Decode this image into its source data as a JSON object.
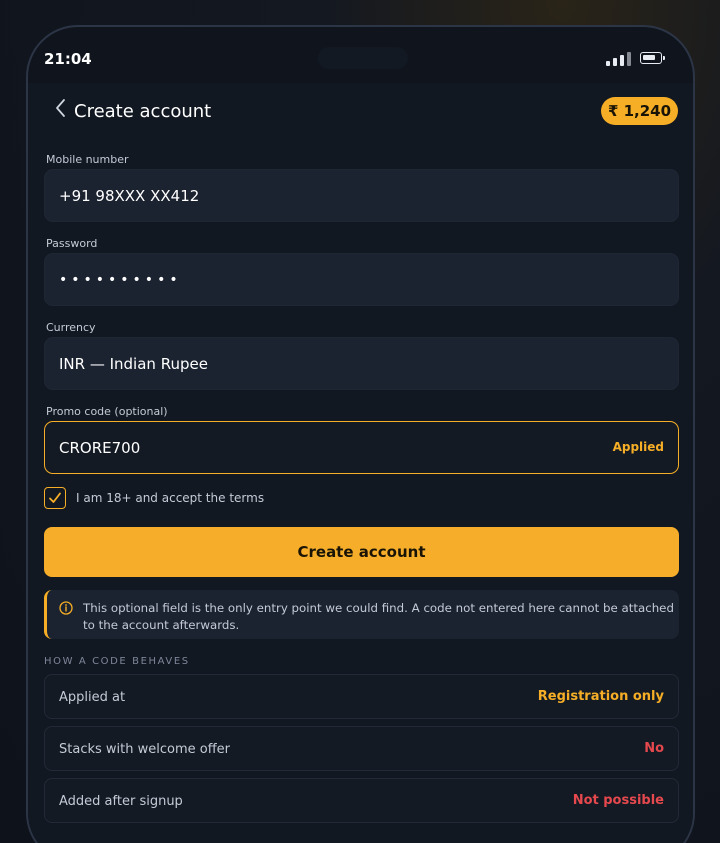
{
  "status_bar": {
    "time": "21:04"
  },
  "header": {
    "title": "Create account",
    "balance": "₹ 1,240"
  },
  "form": {
    "mobile": {
      "label": "Mobile number",
      "value": "+91 98XXX XX412"
    },
    "password": {
      "label": "Password",
      "value": "••••••••••"
    },
    "currency": {
      "label": "Currency",
      "value": "INR — Indian Rupee"
    },
    "promo": {
      "label": "Promo code (optional)",
      "value": "CRORE700",
      "status": "Applied"
    },
    "terms": {
      "label": "I am 18+ and accept the terms",
      "checked": true
    },
    "submit_label": "Create account"
  },
  "notice": {
    "text": "This optional field is the only entry point we could find. A code not entered here cannot be attached to the account afterwards."
  },
  "code_behaviour": {
    "title": "HOW A CODE BEHAVES",
    "rows": [
      {
        "label": "Applied at",
        "value": "Registration only",
        "color": "#f5ae26"
      },
      {
        "label": "Stacks with welcome offer",
        "value": "No",
        "color": "#e5484d"
      },
      {
        "label": "Added after signup",
        "value": "Not possible",
        "color": "#e5484d"
      }
    ]
  },
  "colors": {
    "accent": "#f5ae26",
    "negative": "#e5484d",
    "background": "#121822"
  }
}
